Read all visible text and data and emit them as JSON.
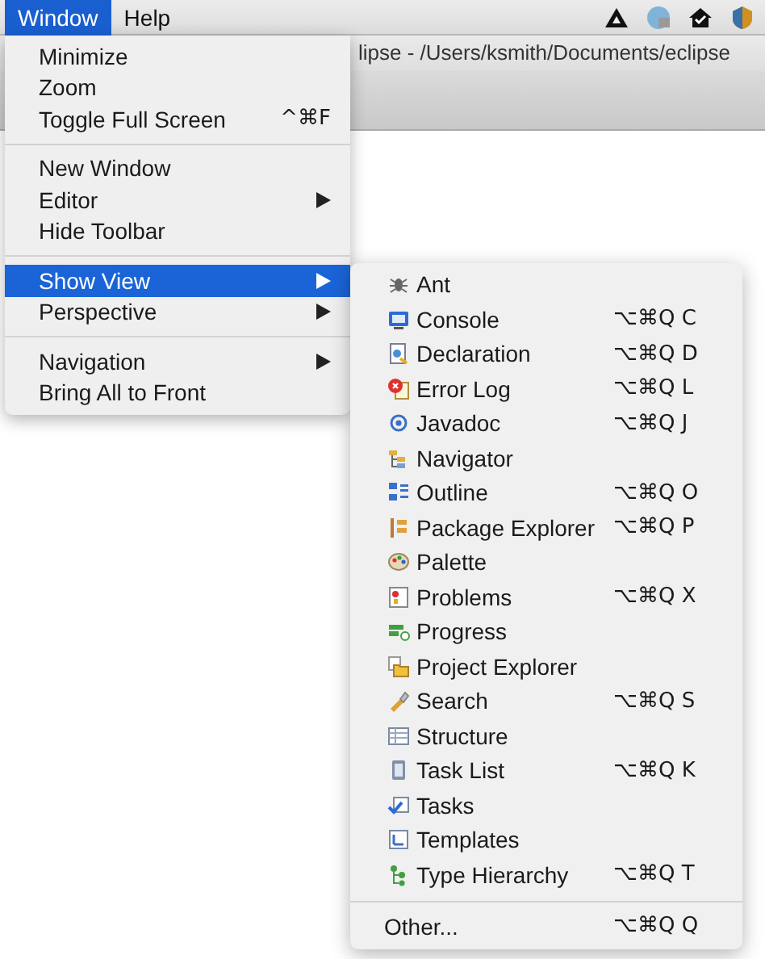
{
  "menubar": {
    "menus": [
      {
        "label": "Window",
        "selected": true
      },
      {
        "label": "Help",
        "selected": false
      }
    ]
  },
  "window": {
    "title": "lipse - /Users/ksmith/Documents/eclipse"
  },
  "window_menu": {
    "groups": [
      [
        {
          "label": "Minimize",
          "selected": false,
          "submenu": false
        },
        {
          "label": "Zoom",
          "selected": false,
          "submenu": false
        },
        {
          "label": "Toggle Full Screen",
          "shortcut": "^⌘F",
          "selected": false,
          "submenu": false
        }
      ],
      [
        {
          "label": "New Window",
          "selected": false,
          "submenu": false
        },
        {
          "label": "Editor",
          "selected": false,
          "submenu": true
        },
        {
          "label": "Hide Toolbar",
          "selected": false,
          "submenu": false
        }
      ],
      [
        {
          "label": "Show View",
          "selected": true,
          "submenu": true
        },
        {
          "label": "Perspective",
          "selected": false,
          "submenu": true
        }
      ],
      [
        {
          "label": "Navigation",
          "selected": false,
          "submenu": true
        },
        {
          "label": "Bring All to Front",
          "selected": false,
          "submenu": false
        }
      ]
    ]
  },
  "show_view_menu": {
    "items": [
      {
        "label": "Ant"
      },
      {
        "label": "Console",
        "shortcut": "⌥⌘Q C"
      },
      {
        "label": "Declaration",
        "shortcut": "⌥⌘Q D"
      },
      {
        "label": "Error Log",
        "shortcut": "⌥⌘Q L"
      },
      {
        "label": "Javadoc",
        "shortcut": "⌥⌘Q J"
      },
      {
        "label": "Navigator"
      },
      {
        "label": "Outline",
        "shortcut": "⌥⌘Q O"
      },
      {
        "label": "Package Explorer",
        "shortcut": "⌥⌘Q P"
      },
      {
        "label": "Palette"
      },
      {
        "label": "Problems",
        "shortcut": "⌥⌘Q X"
      },
      {
        "label": "Progress"
      },
      {
        "label": "Project Explorer"
      },
      {
        "label": "Search",
        "shortcut": "⌥⌘Q S"
      },
      {
        "label": "Structure"
      },
      {
        "label": "Task List",
        "shortcut": "⌥⌘Q K"
      },
      {
        "label": "Tasks"
      },
      {
        "label": "Templates"
      },
      {
        "label": "Type Hierarchy",
        "shortcut": "⌥⌘Q T"
      }
    ],
    "footer": {
      "label": "Other...",
      "shortcut": "⌥⌘Q Q"
    }
  }
}
